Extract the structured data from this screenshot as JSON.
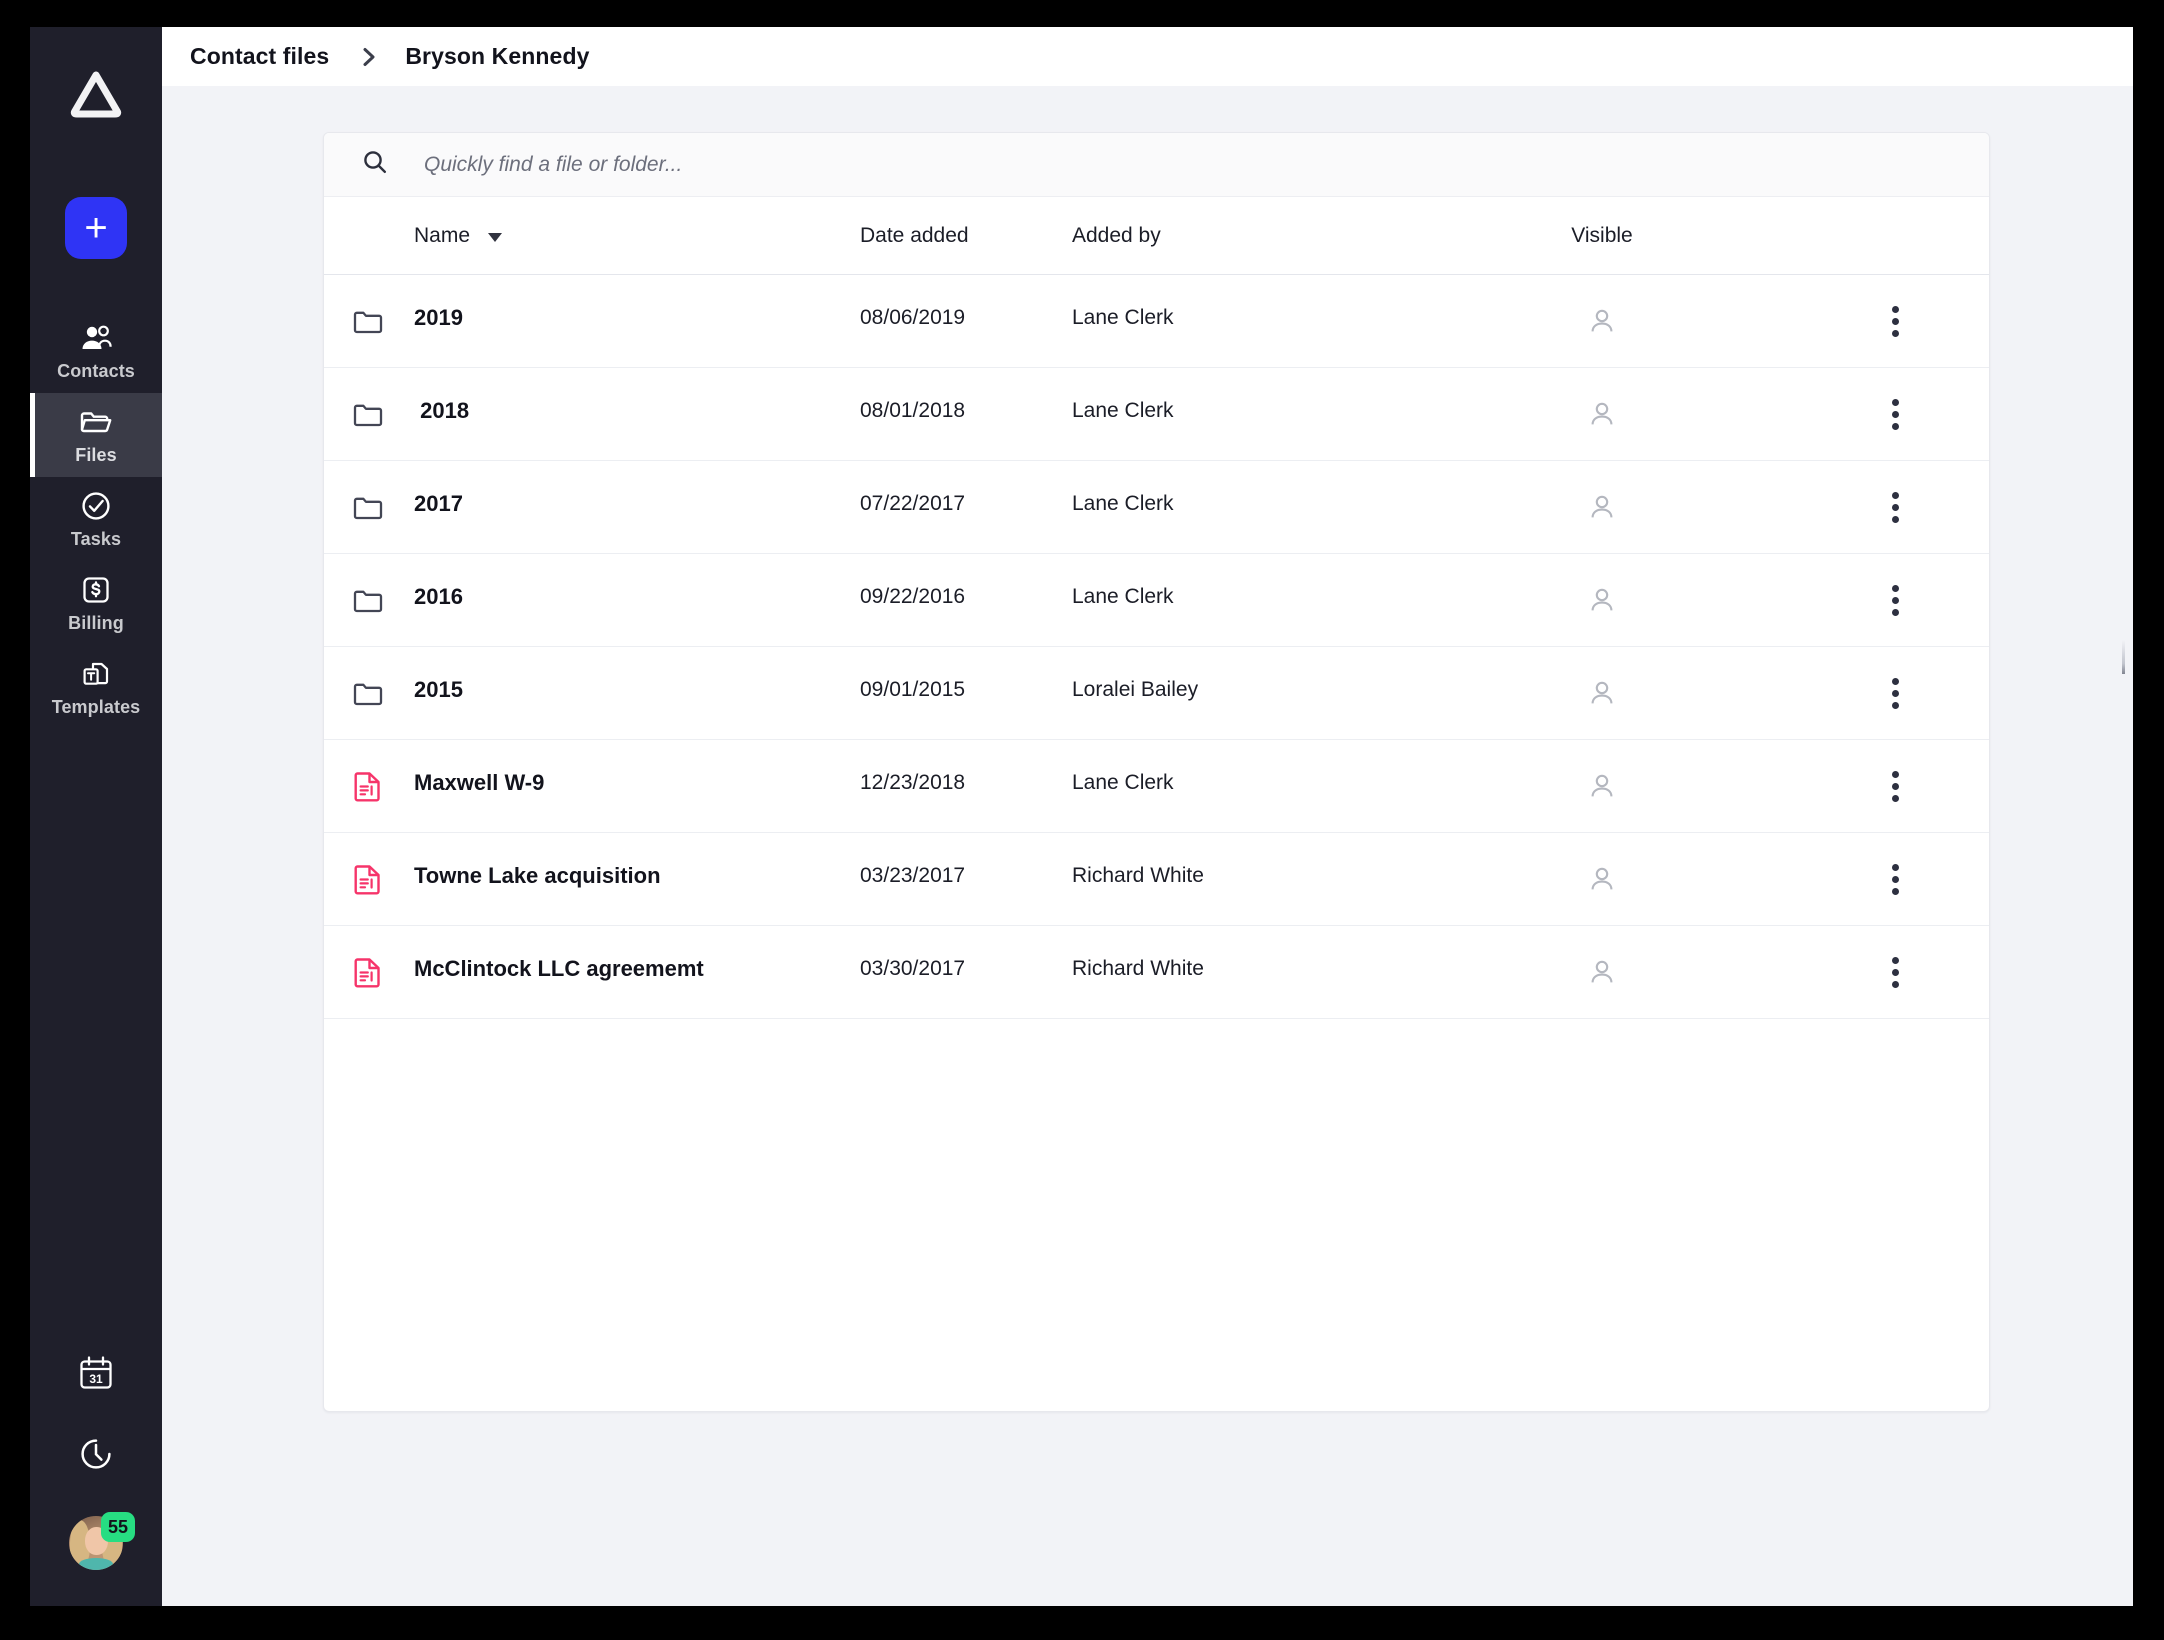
{
  "app": {
    "logo_icon": "triangle-logo",
    "add_button": {
      "icon": "plus-icon",
      "label": "+"
    }
  },
  "sidebar": {
    "items": [
      {
        "label": "Contacts",
        "icon": "contacts-icon",
        "active": false
      },
      {
        "label": "Files",
        "icon": "folder-icon",
        "active": true
      },
      {
        "label": "Tasks",
        "icon": "check-circle-icon",
        "active": false
      },
      {
        "label": "Billing",
        "icon": "dollar-square-icon",
        "active": false
      },
      {
        "label": "Templates",
        "icon": "templates-icon",
        "active": false
      }
    ],
    "bottom": {
      "calendar_icon": "calendar-icon",
      "calendar_day": "31",
      "timer_icon": "timer-icon",
      "avatar_icon": "user-avatar",
      "badge_count": "55",
      "badge_color": "#27dd82"
    }
  },
  "header": {
    "breadcrumb": {
      "parent": "Contact files",
      "separator_icon": "chevron-right-icon",
      "current": "Bryson Kennedy"
    }
  },
  "search": {
    "icon": "search-icon",
    "placeholder": "Quickly find a file or folder...",
    "value": ""
  },
  "table": {
    "columns": {
      "name": "Name",
      "sort_icon": "caret-down-icon",
      "date_added": "Date added",
      "added_by": "Added by",
      "visible": "Visible"
    },
    "rows": [
      {
        "icon": "folder-icon",
        "name": "2019",
        "date": "08/06/2019",
        "by": "Lane Clerk",
        "visible_icon": "person-icon",
        "menu_icon": "kebab-menu-icon"
      },
      {
        "icon": "folder-icon",
        "name": " 2018",
        "date": "08/01/2018",
        "by": "Lane Clerk",
        "visible_icon": "person-icon",
        "menu_icon": "kebab-menu-icon"
      },
      {
        "icon": "folder-icon",
        "name": "2017",
        "date": "07/22/2017",
        "by": "Lane Clerk",
        "visible_icon": "person-icon",
        "menu_icon": "kebab-menu-icon"
      },
      {
        "icon": "folder-icon",
        "name": "2016",
        "date": "09/22/2016",
        "by": "Lane Clerk",
        "visible_icon": "person-icon",
        "menu_icon": "kebab-menu-icon"
      },
      {
        "icon": "folder-icon",
        "name": "2015",
        "date": "09/01/2015",
        "by": "Loralei Bailey",
        "visible_icon": "person-icon",
        "menu_icon": "kebab-menu-icon"
      },
      {
        "icon": "document-icon",
        "name": "Maxwell W-9",
        "date": "12/23/2018",
        "by": "Lane Clerk",
        "visible_icon": "person-icon",
        "menu_icon": "kebab-menu-icon"
      },
      {
        "icon": "document-icon",
        "name": "Towne Lake acquisition",
        "date": "03/23/2017",
        "by": "Richard White",
        "visible_icon": "person-icon",
        "menu_icon": "kebab-menu-icon"
      },
      {
        "icon": "document-icon",
        "name": "McClintock LLC agreememt",
        "date": "03/30/2017",
        "by": "Richard White",
        "visible_icon": "person-icon",
        "menu_icon": "kebab-menu-icon"
      }
    ]
  },
  "colors": {
    "sidebar_bg": "#1f1f2b",
    "sidebar_active_bg": "#3a3b47",
    "accent_blue": "#2f34f5",
    "file_red": "#f6346a",
    "page_bg": "#f2f3f7",
    "text_dark": "#12131c"
  }
}
